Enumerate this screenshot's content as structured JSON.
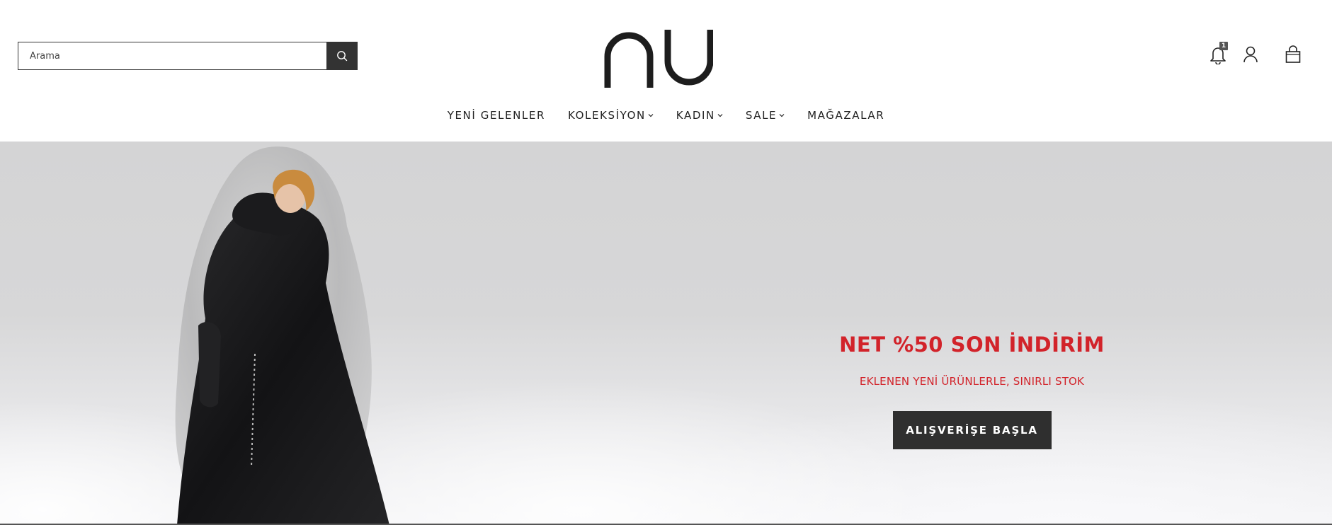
{
  "search": {
    "placeholder": "Arama"
  },
  "header": {
    "logo_text": "nu",
    "notification_count": "1"
  },
  "nav": {
    "items": [
      {
        "label": "YENİ GELENLER",
        "has_dropdown": false
      },
      {
        "label": "KOLEKSİYON",
        "has_dropdown": true
      },
      {
        "label": "KADIN",
        "has_dropdown": true
      },
      {
        "label": "SALE",
        "has_dropdown": true
      },
      {
        "label": "MAĞAZALAR",
        "has_dropdown": false
      }
    ]
  },
  "hero": {
    "title": "NET %50 SON İNDİRİM",
    "subtitle": "EKLENEN YENİ ÜRÜNLERLE, SINIRLI STOK",
    "cta_label": "ALIŞVERİŞE BAŞLA"
  },
  "colors": {
    "accent": "#d2232a",
    "button_dark": "#2f2f2f",
    "text": "#222222"
  },
  "icons": [
    "search-icon",
    "bell-icon",
    "user-icon",
    "bag-icon",
    "chevron-down-icon"
  ]
}
